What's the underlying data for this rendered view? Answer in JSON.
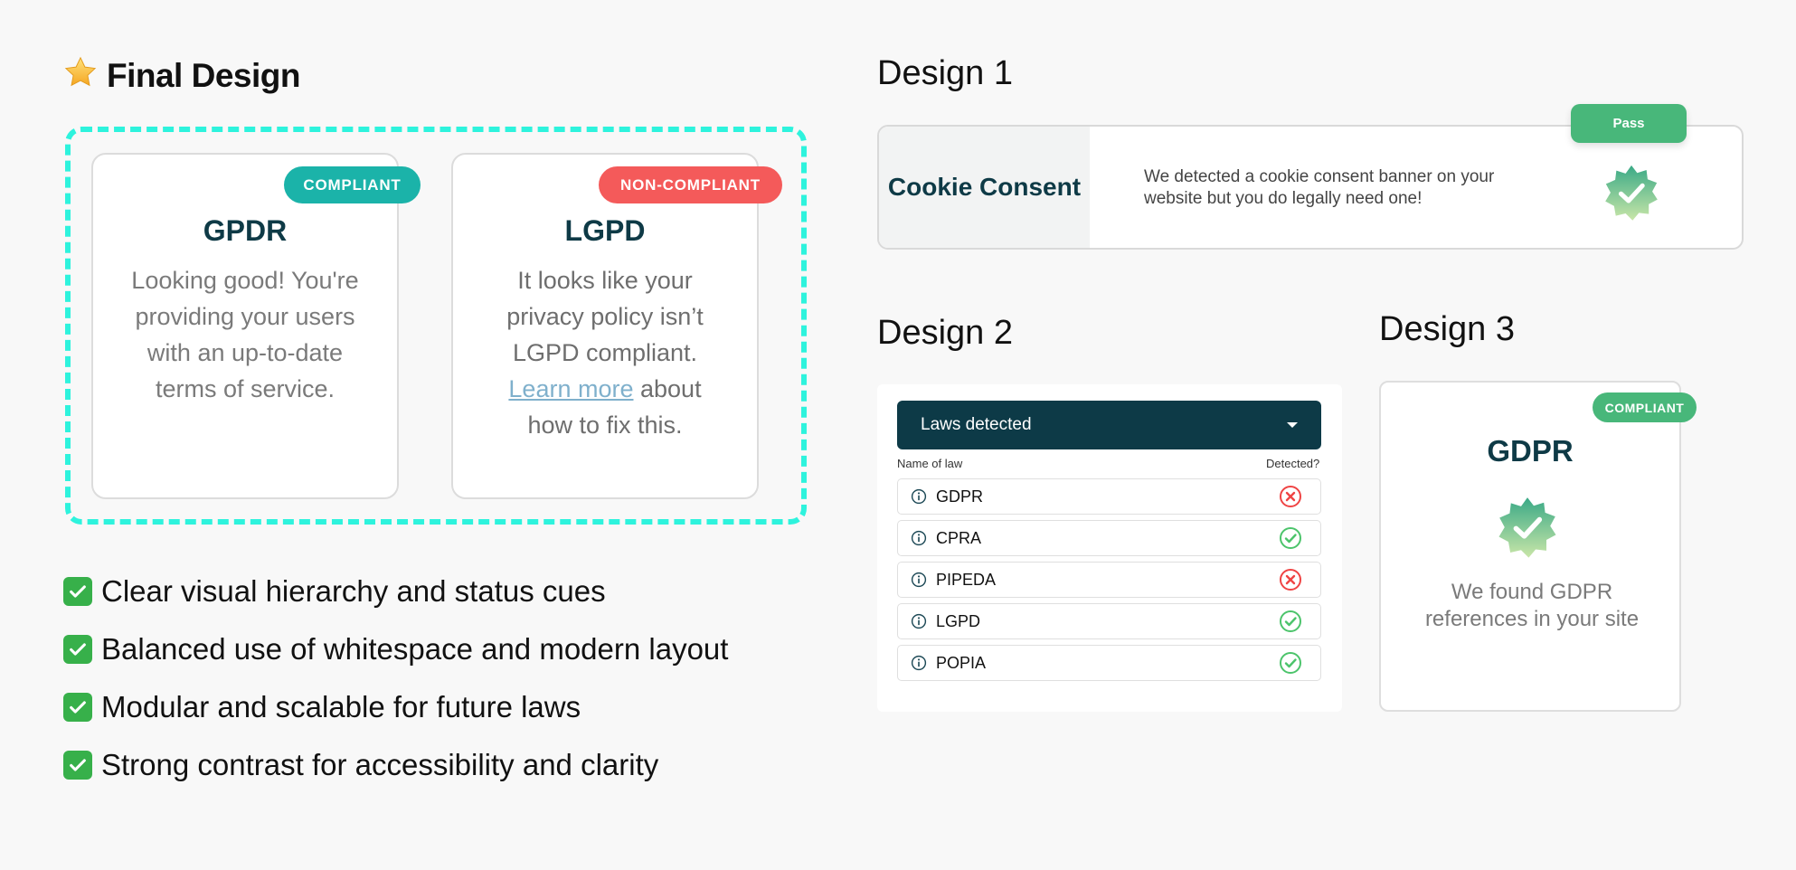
{
  "final_design": {
    "title": "Final Design",
    "title_icon": "star-icon",
    "cards": [
      {
        "title": "GPDR",
        "status": "COMPLIANT",
        "status_color": "#1bb3a9",
        "body": "Looking good! You're providing your users with an up-to-date terms of service."
      },
      {
        "title": "LGPD",
        "status": "NON-COMPLIANT",
        "status_color": "#f45a5a",
        "body_before": "It looks like your privacy policy isn’t LGPD compliant.",
        "link": "Learn more",
        "body_after": "about how to fix this."
      }
    ],
    "frame_color": "#2ef3dd",
    "bullets": [
      "Clear visual hierarchy and status cues",
      "Balanced use of whitespace and modern layout",
      "Modular and scalable for future laws",
      "Strong contrast for accessibility and clarity"
    ],
    "bullet_icon": "check-mark-button-icon"
  },
  "design1": {
    "heading": "Design 1",
    "side_label": "Cookie Consent",
    "text": "We detected a cookie consent banner on your website but you do legally need one!",
    "pass_label": "Pass",
    "badge_icon": "verified-badge-icon"
  },
  "design2": {
    "heading": "Design 2",
    "dropdown_label": "Laws detected",
    "col_name": "Name of law",
    "col_detected": "Detected?",
    "rows": [
      {
        "name": "GDPR",
        "detected": false
      },
      {
        "name": "CPRA",
        "detected": true
      },
      {
        "name": "PIPEDA",
        "detected": false
      },
      {
        "name": "LGPD",
        "detected": true
      },
      {
        "name": "POPIA",
        "detected": true
      }
    ]
  },
  "design3": {
    "heading": "Design 3",
    "title": "GDPR",
    "status": "COMPLIANT",
    "text": "We found GDPR references in your site",
    "badge_icon": "verified-badge-icon"
  },
  "colors": {
    "brand_dark": "#0e3a46",
    "compliant": "#1bb3a9",
    "non_compliant": "#f45a5a",
    "pass_green": "#48b77a"
  }
}
